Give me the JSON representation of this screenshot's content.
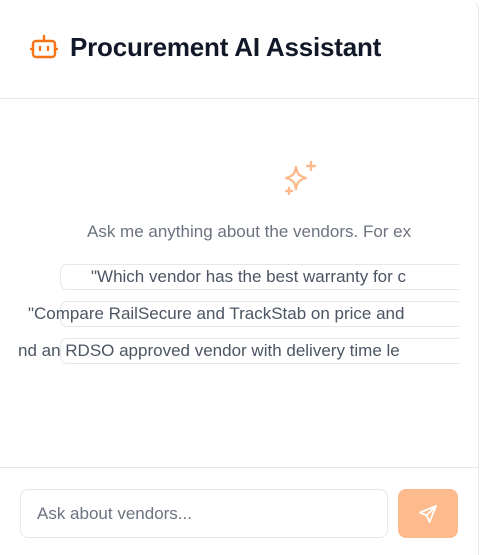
{
  "header": {
    "title": "Procurement AI Assistant",
    "icon": "robot-icon",
    "accent_color": "#f97316"
  },
  "empty_state": {
    "icon": "sparkles-icon",
    "intro": "Ask me anything about the vendors. For ex",
    "example_prompts": [
      "\"Which vendor has the best warranty for c",
      "\"Compare RailSecure and TrackStab on price and",
      "nd an RDSO approved vendor with delivery time le"
    ]
  },
  "composer": {
    "placeholder": "Ask about vendors...",
    "send_icon": "send-icon",
    "send_color": "#fdba8c"
  }
}
